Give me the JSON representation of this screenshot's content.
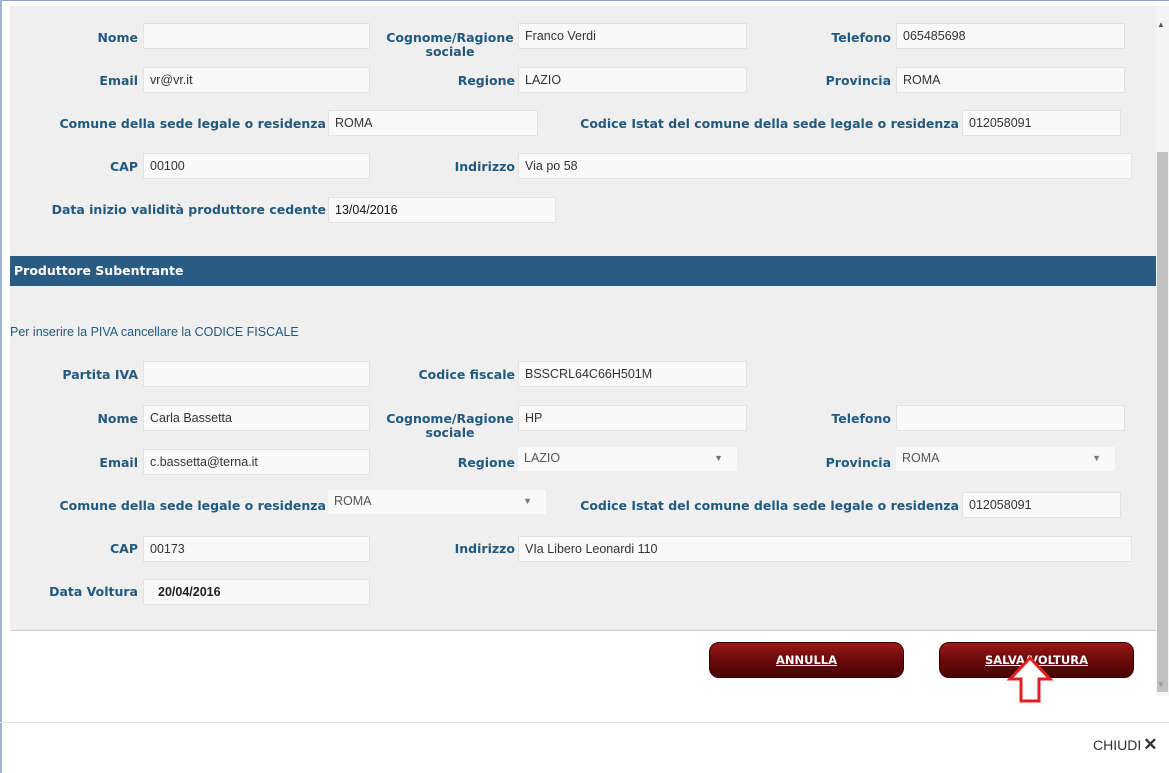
{
  "cedente": {
    "nome": {
      "label": "Nome",
      "value": ""
    },
    "cognome": {
      "label": "Cognome/Ragione sociale",
      "value": "Franco Verdi"
    },
    "telefono": {
      "label": "Telefono",
      "value": "065485698"
    },
    "email": {
      "label": "Email",
      "value": "vr@vr.it"
    },
    "regione": {
      "label": "Regione",
      "value": "LAZIO"
    },
    "provincia": {
      "label": "Provincia",
      "value": "ROMA"
    },
    "comune": {
      "label": "Comune della sede legale o residenza",
      "value": "ROMA"
    },
    "istat": {
      "label": "Codice Istat del comune della sede legale o residenza",
      "value": "012058091"
    },
    "cap": {
      "label": "CAP",
      "value": "00100"
    },
    "indirizzo": {
      "label": "Indirizzo",
      "value": "Via po 58"
    },
    "data_inizio": {
      "label": "Data inizio validità produttore cedente",
      "value": "13/04/2016"
    }
  },
  "subentrante": {
    "section_title": "Produttore Subentrante",
    "hint": "Per inserire la PIVA cancellare la CODICE FISCALE",
    "partita_iva": {
      "label": "Partita IVA",
      "value": ""
    },
    "codice_fiscale": {
      "label": "Codice fiscale",
      "value": "BSSCRL64C66H501M"
    },
    "nome": {
      "label": "Nome",
      "value": "Carla Bassetta"
    },
    "cognome": {
      "label": "Cognome/Ragione sociale",
      "value": "HP"
    },
    "telefono": {
      "label": "Telefono",
      "value": ""
    },
    "email": {
      "label": "Email",
      "value": "c.bassetta@terna.it"
    },
    "regione": {
      "label": "Regione",
      "value": "LAZIO"
    },
    "provincia": {
      "label": "Provincia",
      "value": "ROMA"
    },
    "comune": {
      "label": "Comune della sede legale o residenza",
      "value": "ROMA"
    },
    "istat": {
      "label": "Codice Istat del comune della sede legale o residenza",
      "value": "012058091"
    },
    "cap": {
      "label": "CAP",
      "value": "00173"
    },
    "indirizzo": {
      "label": "Indirizzo",
      "value": "VIa Libero Leonardi 110"
    },
    "data_voltura": {
      "label": "Data Voltura",
      "value": "20/04/2016"
    }
  },
  "buttons": {
    "annulla": "ANNULLA",
    "salva": "SALVA/VOLTURA"
  },
  "footer": {
    "chiudi": "CHIUDI"
  },
  "icons": {
    "close": "close-icon",
    "annotation_arrow": "arrow-up-icon",
    "dropdown": "chevron-down-icon"
  },
  "colors": {
    "section_bar": "#2a5b82",
    "label": "#215a7e",
    "button": "#6e0b0b",
    "annotation": "#e02020"
  }
}
